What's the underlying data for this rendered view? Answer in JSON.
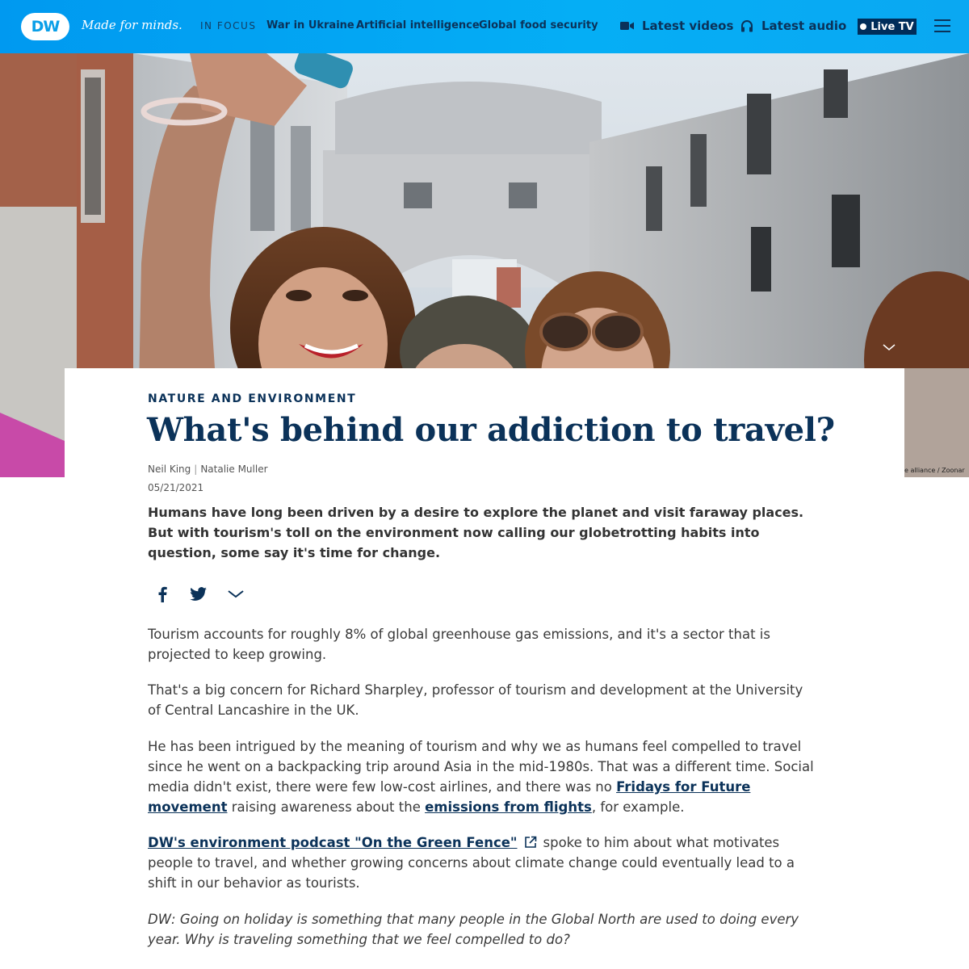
{
  "header": {
    "logo_text": "DW",
    "tagline": "Made for minds.",
    "in_focus_label": "IN FOCUS",
    "focus_links": [
      "War in Ukraine",
      "Artificial intelligence",
      "Global food security"
    ],
    "latest_videos": "Latest videos",
    "latest_audio": "Latest audio",
    "live_tv": "Live TV",
    "colors": {
      "bar": "#05aef5",
      "text_dark": "#0b3259",
      "live_bg": "#002d5a"
    }
  },
  "hero": {
    "photo_credit": "e alliance / Zoonar"
  },
  "article": {
    "kicker": "NATURE AND ENVIRONMENT",
    "title": "What's behind our addiction to travel?",
    "authors": [
      "Neil King",
      "Natalie Muller"
    ],
    "date": "05/21/2021",
    "lead": "Humans have long been driven by a desire to explore the planet and visit faraway places. But with tourism's toll on the environment now calling our globetrotting habits into question, some say it's time for change.",
    "share_icons": [
      "facebook-icon",
      "twitter-icon",
      "chevron-down-icon"
    ],
    "paragraphs": {
      "p1": "Tourism accounts for roughly 8% of global greenhouse gas emissions, and it's a sector that is projected to keep growing.",
      "p2": "That's a big concern for Richard Sharpley, professor of tourism and development at the University of Central Lancashire in the UK.",
      "p3_a": "He has been intrigued by the meaning of tourism and why we as humans feel compelled to travel since he went on a backpacking trip around Asia in the mid-1980s. That was a different time. Social media didn't exist, there were few low-cost airlines, and there was no ",
      "p3_link1": "Fridays for Future movement",
      "p3_b": " raising awareness about the ",
      "p3_link2": "emissions from flights",
      "p3_c": ", for example.",
      "p4_link": "DW's environment podcast \"On the Green Fence\"",
      "p4_text": "spoke to him about what motivates people to travel, and whether growing concerns about climate change could eventually lead to a shift in our behavior as tourists.",
      "q1_label": "DW",
      "q1_text": ": Going on holiday is something that many people in the Global North are used to doing every year. Why is traveling something that we feel compelled to do?"
    }
  }
}
